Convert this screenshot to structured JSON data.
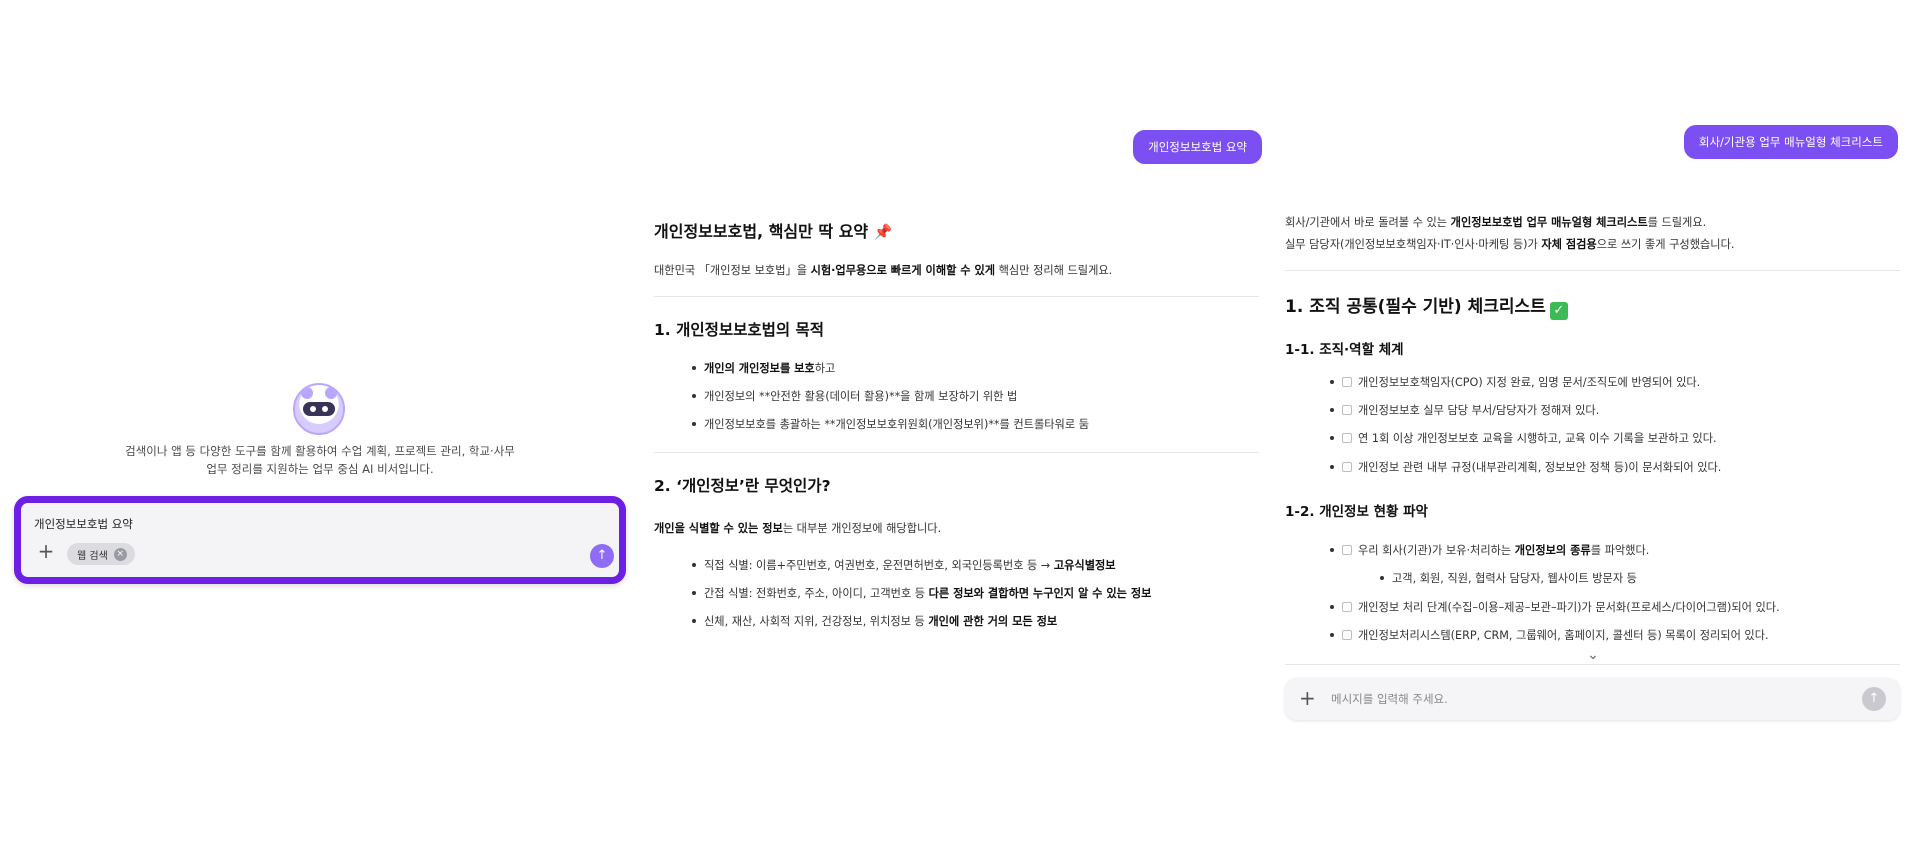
{
  "left_panel": {
    "intro_line1": "검색이나 앱 등 다양한 도구를 함께 활용하여 수업 계획, 프로젝트 관리, 학교·사무",
    "intro_line2": "업무 정리를 지원하는 업무 중심 AI 비서입니다.",
    "query": "개인정보보호법 요약",
    "chip_label": "웹 검색",
    "plus_icon": "+",
    "send_icon": "↑",
    "chip_remove_icon": "×"
  },
  "middle_panel": {
    "user_bubble": "개인정보보호법 요약",
    "title": "개인정보보호법, 핵심만 딱 요약",
    "title_emoji": "📌",
    "intro_pre": "대한민국 「개인정보 보호법」을 ",
    "intro_bold": "시험·업무용으로 빠르게 이해할 수 있게",
    "intro_post": " 핵심만 정리해 드릴게요.",
    "section1_title": "1. 개인정보보호법의 목적",
    "section1_items": [
      {
        "bold": "개인의 개인정보를 보호",
        "rest": "하고"
      },
      {
        "bold": "",
        "rest": "개인정보의 **안전한 활용(데이터 활용)**을 함께 보장하기 위한 법"
      },
      {
        "bold": "",
        "rest": "개인정보보호를 총괄하는 **개인정보보호위원회(개인정보위)**를 컨트롤타워로 둠"
      }
    ],
    "section2_title": "2. ‘개인정보’란 무엇인가?",
    "section2_intro_bold": "개인을 식별할 수 있는 정보",
    "section2_intro_rest": "는 대부분 개인정보에 해당합니다.",
    "section2_items": [
      {
        "text": "직접 식별: 이름+주민번호, 여권번호, 운전면허번호, 외국인등록번호 등 → ",
        "bold": "고유식별정보"
      },
      {
        "text": "간접 식별: 전화번호, 주소, 아이디, 고객번호 등 ",
        "bold": "다른 정보와 결합하면 누구인지 알 수 있는 정보"
      },
      {
        "text": "신체, 재산, 사회적 지위, 건강정보, 위치정보 등 ",
        "bold": "개인에 관한 거의 모든 정보"
      }
    ]
  },
  "right_panel": {
    "user_bubble": "회사/기관용 업무 매뉴얼형 체크리스트",
    "intro1_pre": "회사/기관에서 바로 돌려볼 수 있는 ",
    "intro1_bold": "개인정보보호법 업무 매뉴얼형 체크리스트",
    "intro1_post": "를 드릴게요.",
    "intro2_pre": "실무 담당자(개인정보보호책임자·IT·인사·마케팅 등)가 ",
    "intro2_bold": "자체 점검용",
    "intro2_post": "으로 쓰기 좋게 구성했습니다.",
    "section1_title": "1. 조직 공통(필수 기반) 체크리스트",
    "section1_emoji": "✓",
    "sub1_title": "1-1. 조직·역할 체계",
    "sub1_items": [
      "개인정보보호책임자(CPO) 지정 완료, 임명 문서/조직도에 반영되어 있다.",
      "개인정보보호 실무 담당 부서/담당자가 정해져 있다.",
      "연 1회 이상 개인정보보호 교육을 시행하고, 교육 이수 기록을 보관하고 있다.",
      "개인정보 관련 내부 규정(내부관리계획, 정보보안 정책 등)이 문서화되어 있다."
    ],
    "sub2_title": "1-2. 개인정보 현황 파악",
    "sub2_item1_pre": "우리 회사(기관)가 보유·처리하는 ",
    "sub2_item1_bold": "개인정보의 종류",
    "sub2_item1_post": "를 파악했다.",
    "sub2_subitem": "고객, 회원, 직원, 협력사 담당자, 웹사이트 방문자 등",
    "sub2_item2": "개인정보 처리 단계(수집–이용–제공–보관–파기)가 문서화(프로세스/다이어그램)되어 있다.",
    "sub2_item3": "개인정보처리시스템(ERP, CRM, 그룹웨어, 홈페이지, 콜센터 등) 목록이 정리되어 있다.",
    "input_placeholder": "메시지를 입력해 주세요.",
    "chevron_icon": "⌄",
    "plus_icon": "+",
    "send_icon": "↑"
  }
}
